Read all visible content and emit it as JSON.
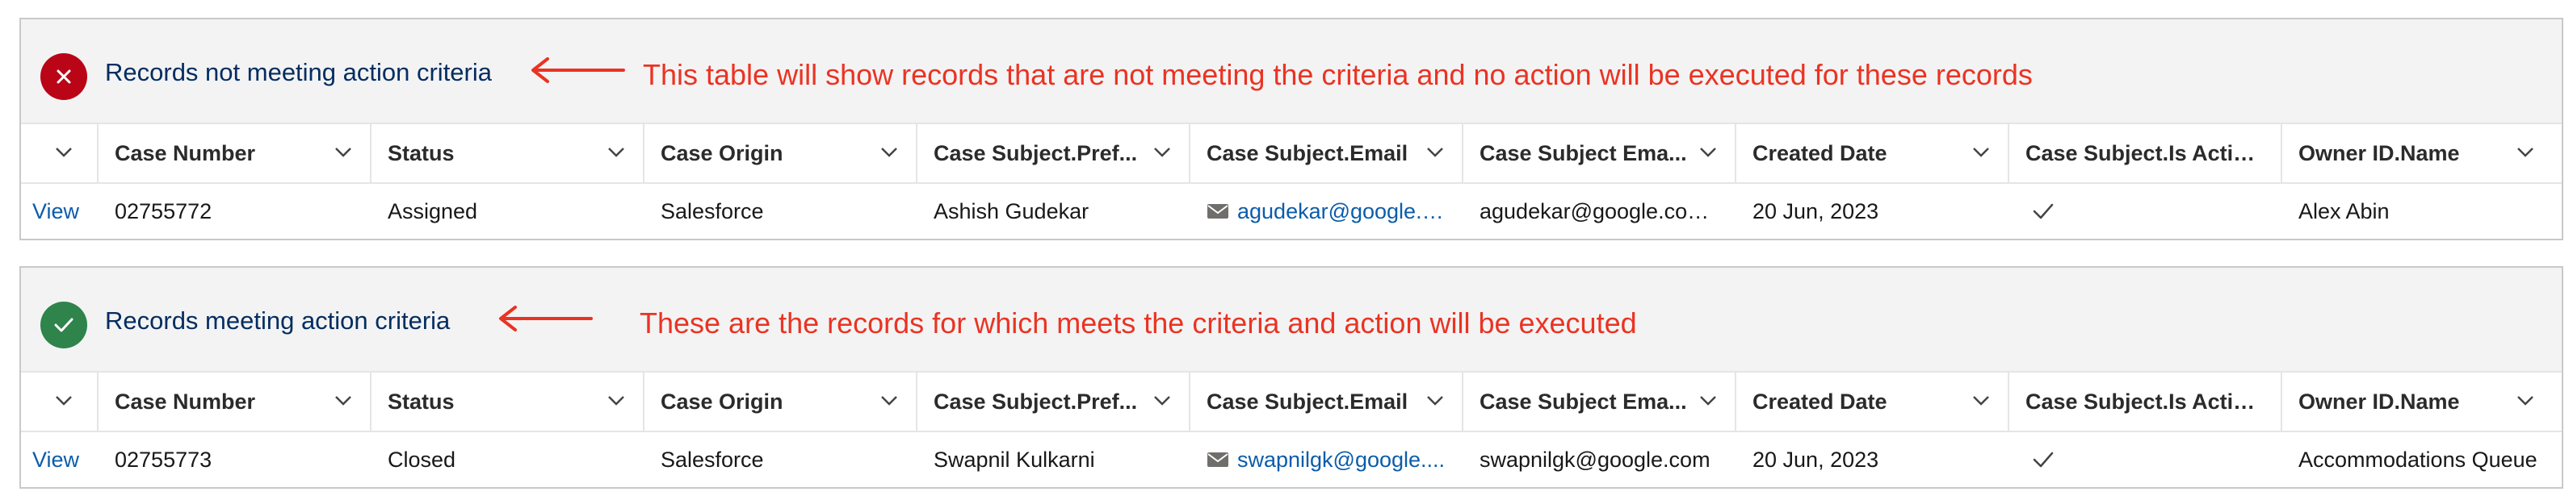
{
  "columns": [
    "Case Number",
    "Status",
    "Case Origin",
    "Case Subject.Pref...",
    "Case Subject.Email",
    "Case Subject Ema...",
    "Created Date",
    "Case Subject.Is Active?",
    "Owner ID.Name"
  ],
  "colors": {
    "error": "#ba0517",
    "success": "#2e844a",
    "annotation": "#ea3323",
    "link": "#0b5cab"
  },
  "panels": [
    {
      "status_icon": "close-icon",
      "title": "Records not meeting action criteria",
      "annotation": "This table will show records that are not meeting the criteria and no action will be executed for these records",
      "row": {
        "action": "View",
        "case_number": "02755772",
        "status": "Assigned",
        "case_origin": "Salesforce",
        "subject_pref": "Ashish Gudekar",
        "subject_email": "agudekar@google.c...",
        "subject_email_alt": "agudekar@google.com...",
        "created_date": "20 Jun, 2023",
        "is_active_icon": "check-icon",
        "owner": "Alex Abin"
      }
    },
    {
      "status_icon": "check-icon",
      "title": "Records meeting action criteria",
      "annotation": "These are the records for which meets the criteria and action will be executed",
      "row": {
        "action": "View",
        "case_number": "02755773",
        "status": "Closed",
        "case_origin": "Salesforce",
        "subject_pref": "Swapnil Kulkarni",
        "subject_email": "swapnilgk@google....",
        "subject_email_alt": "swapnilgk@google.com",
        "created_date": "20 Jun, 2023",
        "is_active_icon": "check-icon",
        "owner": "Accommodations Queue"
      }
    }
  ]
}
